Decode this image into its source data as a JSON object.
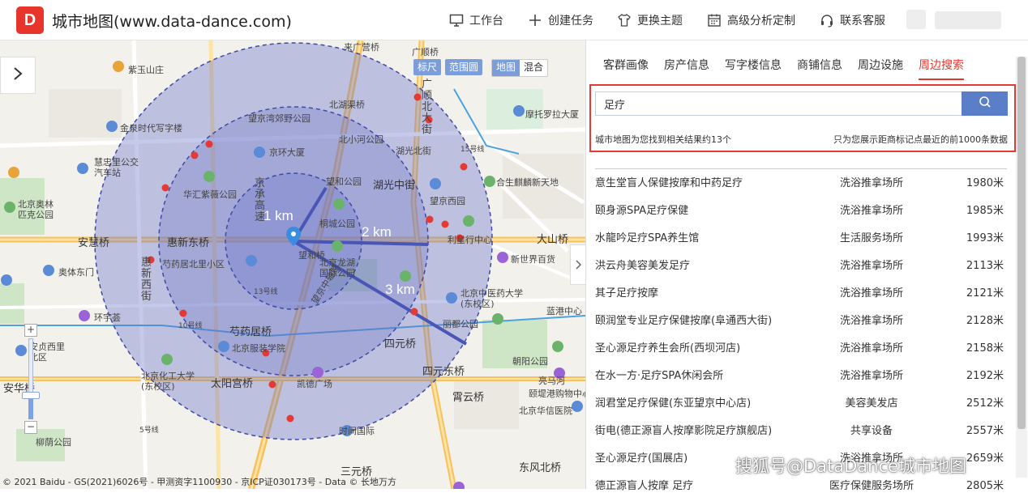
{
  "header": {
    "logo_text": "D",
    "title": "城市地图(www.data-dance.com)",
    "nav": [
      {
        "label": "工作台",
        "icon": "monitor-icon"
      },
      {
        "label": "创建任务",
        "icon": "plus-icon"
      },
      {
        "label": "更换主题",
        "icon": "shirt-icon"
      },
      {
        "label": "高级分析定制",
        "icon": "calendar-icon"
      },
      {
        "label": "联系客服",
        "icon": "headset-icon"
      }
    ]
  },
  "map": {
    "tools": [
      "标尺",
      "范围圆"
    ],
    "map_types": [
      "地图",
      "混合"
    ],
    "radius_labels": [
      "1 km",
      "2 km",
      "3 km"
    ],
    "labels": [
      "紫玉山庄",
      "金泉时代写字楼",
      "慧忠里公交汽车站",
      "北京奥林匹克公园",
      "安慧桥",
      "惠新东桥",
      "芍药居北里小区",
      "奥体东门",
      "环宇荟",
      "安贞西里北区",
      "安华桥",
      "北京化工大学(东校区)",
      "太阳宫桥",
      "芍药居桥",
      "北京服装学院",
      "凯德广场",
      "时间国际",
      "柳荫公园",
      "北湖渠桥",
      "望京湾郊野公园",
      "京环大厦",
      "北小河公园",
      "望和公园",
      "华汇紫薇公园",
      "湖光北街",
      "湖光中街",
      "望京西园",
      "桐城公园",
      "北京龙湖国际公园",
      "望和桥",
      "北京中医药大学(东校区)",
      "丽都公园",
      "四元桥",
      "四元东桥",
      "三元桥",
      "霄云桥",
      "朝阳公园",
      "东风北桥",
      "亮马河",
      "北京华信医院",
      "颐堤港购物中心",
      "蓝港中心",
      "新世界百货",
      "利星行中心",
      "大山桥",
      "合生麒麟新天地",
      "摩托罗拉大厦",
      "广顺桥",
      "广顺北大街",
      "来广营桥",
      "惠新西街",
      "望京中轴路",
      "京承高速",
      "15号线",
      "13号线",
      "10号线",
      "5号线"
    ],
    "copyright": "© 2021 Baidu - GS(2021)6026号 - 甲测资字1100930 - 京ICP证030173号 - Data © 长地万方"
  },
  "panel": {
    "tabs": [
      "客群画像",
      "房产信息",
      "写字楼信息",
      "商铺信息",
      "周边设施",
      "周边搜索"
    ],
    "active_tab": 5,
    "search": {
      "value": "足疗"
    },
    "result_info": "城市地图为您找到相关结果约13个",
    "result_note": "只为您展示距商标记点最近的前1000条数据",
    "results": [
      {
        "name": "意生堂盲人保健按摩和中药足疗",
        "category": "洗浴推拿场所",
        "distance": "1980米"
      },
      {
        "name": "颐身源SPA足疗保健",
        "category": "洗浴推拿场所",
        "distance": "1985米"
      },
      {
        "name": "水龍吟足疗SPA养生馆",
        "category": "生活服务场所",
        "distance": "1993米"
      },
      {
        "name": "洪云舟美容美发足疗",
        "category": "洗浴推拿场所",
        "distance": "2113米"
      },
      {
        "name": "其子足疗按摩",
        "category": "洗浴推拿场所",
        "distance": "2121米"
      },
      {
        "name": "颐润堂专业足疗保健按摩(阜通西大街)",
        "category": "洗浴推拿场所",
        "distance": "2128米"
      },
      {
        "name": "圣心源足疗养生会所(西坝河店)",
        "category": "洗浴推拿场所",
        "distance": "2158米"
      },
      {
        "name": "在水一方·足疗SPA休闲会所",
        "category": "洗浴推拿场所",
        "distance": "2192米"
      },
      {
        "name": "润君堂足疗保健(东亚望京中心店)",
        "category": "美容美发店",
        "distance": "2512米"
      },
      {
        "name": "街电(德正源盲人按摩影院足疗旗舰店)",
        "category": "共享设备",
        "distance": "2557米"
      },
      {
        "name": "圣心源足疗(国展店)",
        "category": "洗浴推拿场所",
        "distance": "2659米"
      },
      {
        "name": "德正源盲人按摩 足疗",
        "category": "医疗保健服务场所",
        "distance": "2805米"
      }
    ],
    "watermark": "搜狐号@DataDance城市地图"
  },
  "colors": {
    "brand_red": "#e8352c",
    "search_blue": "#5b7ec9",
    "circle_fill": "#6670c8",
    "highlight_red": "#e53935"
  }
}
